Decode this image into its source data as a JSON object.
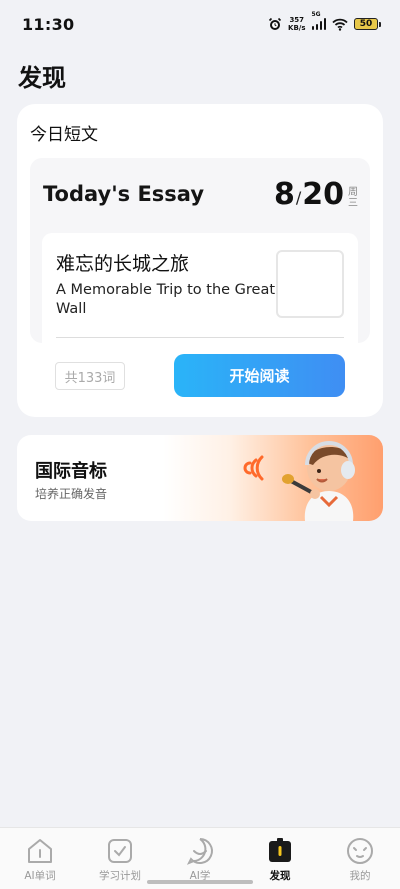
{
  "status_bar": {
    "time": "11:30",
    "net_speed_value": "357",
    "net_speed_unit": "KB/s",
    "network_type": "5G",
    "battery": "50",
    "icons": [
      "alarm-icon",
      "signal-icon",
      "wifi-icon",
      "battery-icon"
    ]
  },
  "page": {
    "title": "发现"
  },
  "essay_card": {
    "section_title": "今日短文",
    "heading": "Today's Essay",
    "date_month": "8",
    "date_separator": "/",
    "date_day": "20",
    "weekday_1": "周",
    "weekday_2": "三",
    "cn_title": "难忘的长城之旅",
    "en_title": "A Memorable Trip to the Great Wall",
    "word_count": "共133词",
    "start_button": "开始阅读",
    "accent_color": "#2ab4f8"
  },
  "phonetic_card": {
    "title": "国际音标",
    "subtitle": "培养正确发音",
    "illustration": "boy-singing-with-microphone",
    "accent_color": "#ff9f6e"
  },
  "bottom_nav": {
    "items": [
      {
        "label": "AI单词",
        "icon": "ai-word-icon",
        "active": false
      },
      {
        "label": "学习计划",
        "icon": "study-plan-icon",
        "active": false
      },
      {
        "label": "AI学",
        "icon": "ai-learn-icon",
        "active": false
      },
      {
        "label": "发现",
        "icon": "discover-icon",
        "active": true
      },
      {
        "label": "我的",
        "icon": "profile-icon",
        "active": false
      }
    ]
  }
}
